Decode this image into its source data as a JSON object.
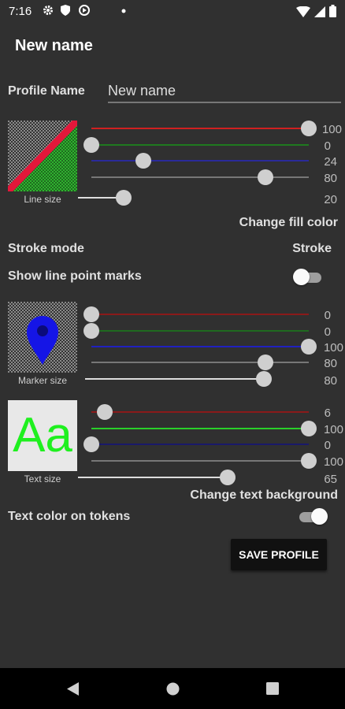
{
  "status_bar": {
    "time": "7:16"
  },
  "title": "New name",
  "profile_name": {
    "label": "Profile Name",
    "value": "New name"
  },
  "line": {
    "sliders": {
      "red": "100",
      "green": "0",
      "blue": "24",
      "alpha": "80"
    },
    "size_label": "Line size",
    "size": "20",
    "fill_color_label": "Change fill color"
  },
  "stroke_mode": {
    "label": "Stroke mode",
    "value": "Stroke"
  },
  "show_line_point_marks": {
    "label": "Show line point marks",
    "on": false
  },
  "marker": {
    "sliders": {
      "red": "0",
      "green": "0",
      "blue": "100",
      "alpha": "80"
    },
    "size_label": "Marker size",
    "size": "80"
  },
  "text": {
    "preview_text": "Aa",
    "sliders": {
      "red": "6",
      "green": "100",
      "blue": "0",
      "alpha": "100"
    },
    "size_label": "Text size",
    "size": "65",
    "background_label": "Change text background"
  },
  "text_color_on_tokens": {
    "label": "Text color on tokens",
    "on": true
  },
  "save_button": "SAVE PROFILE",
  "colors": {
    "background": "#303030",
    "line_red": "#e3173a",
    "line_green": "#2aa52a",
    "marker_blue": "#1515e6",
    "text_green": "#1ff01f"
  }
}
